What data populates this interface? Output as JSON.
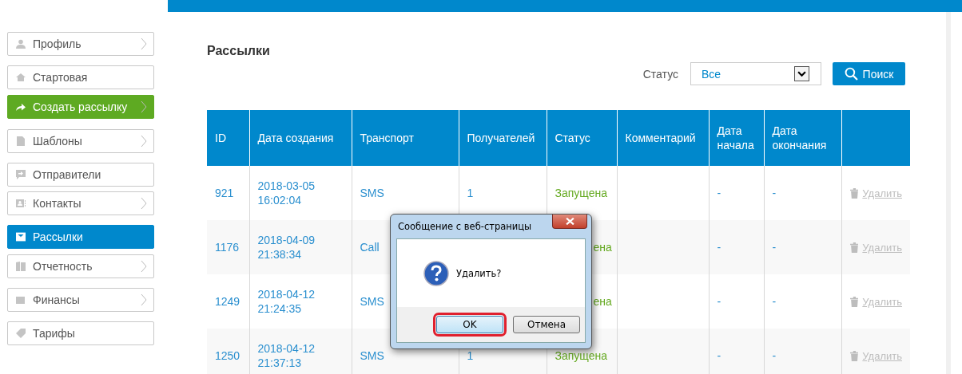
{
  "sidebar": {
    "items": [
      {
        "label": "Профиль",
        "kind": "link",
        "selected": false,
        "chevron": true
      },
      {
        "label": "Стартовая",
        "kind": "link",
        "selected": false,
        "chevron": false
      },
      {
        "label": "Создать рассылку",
        "kind": "action",
        "selected": false,
        "chevron": true
      },
      {
        "label": "Шаблоны",
        "kind": "link",
        "selected": false,
        "chevron": true
      },
      {
        "label": "Отправители",
        "kind": "link",
        "selected": false,
        "chevron": false
      },
      {
        "label": "Контакты",
        "kind": "link",
        "selected": false,
        "chevron": true
      },
      {
        "label": "Рассылки",
        "kind": "link",
        "selected": true,
        "chevron": false
      },
      {
        "label": "Отчетность",
        "kind": "link",
        "selected": false,
        "chevron": true
      },
      {
        "label": "Финансы",
        "kind": "link",
        "selected": false,
        "chevron": true
      },
      {
        "label": "Тарифы",
        "kind": "link",
        "selected": false,
        "chevron": false
      }
    ]
  },
  "page_title": "Рассылки",
  "filter": {
    "label": "Статус",
    "value": "Все",
    "button": "Поиск"
  },
  "table": {
    "columns": [
      "ID",
      "Дата создания",
      "Транспорт",
      "Получателей",
      "Статус",
      "Комментарий",
      "Дата начала",
      "Дата окончания"
    ],
    "rows": [
      {
        "id": "921",
        "date": "2018-03-05",
        "time": "16:02:04",
        "transport": "SMS",
        "recipients": "1",
        "status": "Запущена",
        "status_covered": false,
        "start": "-",
        "end": "-",
        "action": "Удалить"
      },
      {
        "id": "1176",
        "date": "2018-04-09",
        "time": "21:38:34",
        "transport": "Call",
        "status": "ена",
        "status_covered": true,
        "start": "-",
        "end": "-",
        "action": "Удалить"
      },
      {
        "id": "1249",
        "date": "2018-04-12",
        "time": "21:24:35",
        "transport": "SMS",
        "status": "ена",
        "status_covered": true,
        "start": "-",
        "end": "-",
        "action": "Удалить"
      },
      {
        "id": "1250",
        "date": "2018-04-12",
        "time": "21:37:13",
        "transport": "SMS",
        "recipients": "1",
        "status": "Запущена",
        "status_covered": false,
        "start": "-",
        "end": "-",
        "action": "Удалить"
      }
    ]
  },
  "dialog": {
    "title": "Сообщение с веб-страницы",
    "message": "Удалить?",
    "buttons": [
      {
        "label": "OK",
        "highlighted": true
      },
      {
        "label": "Отмена",
        "highlighted": false
      }
    ]
  }
}
